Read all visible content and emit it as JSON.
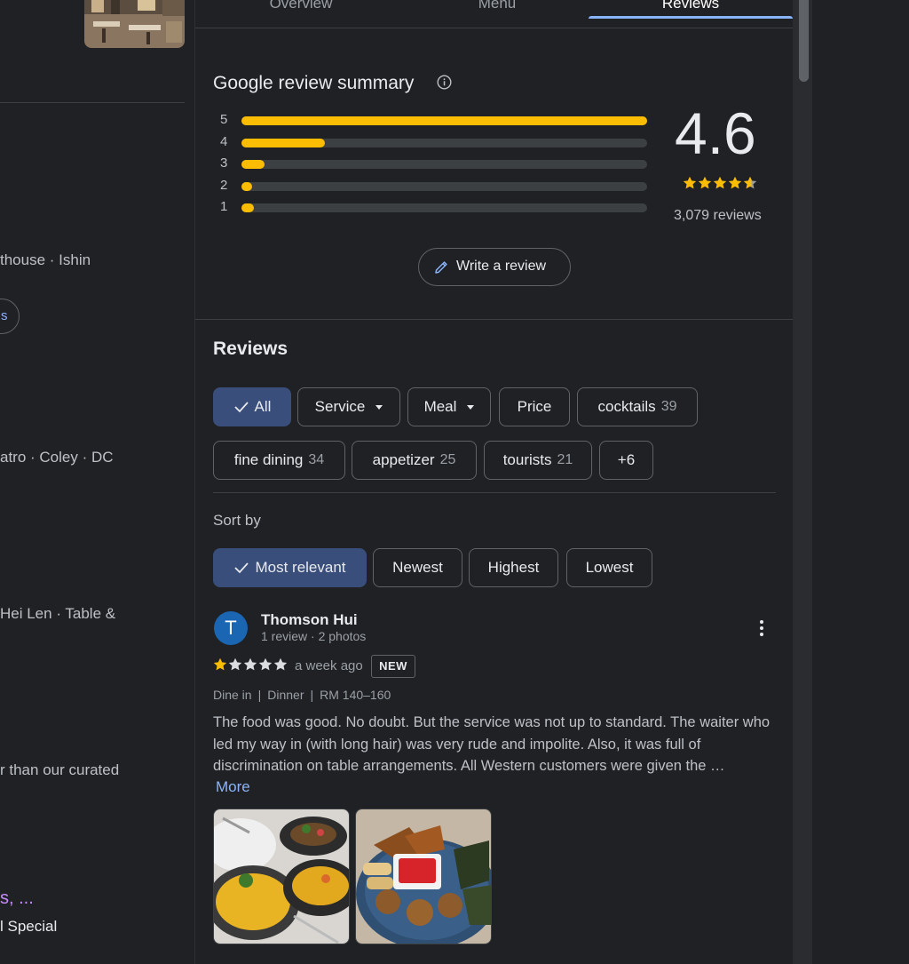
{
  "left": {
    "snippets": [
      "thouse · Ishin",
      "s",
      "atro · Coley · DC",
      "Hei Len · Table &",
      "r than our curated",
      "s, ...",
      "l Special"
    ]
  },
  "tabs": [
    {
      "label": "Overview",
      "active": false
    },
    {
      "label": "Menu",
      "active": false
    },
    {
      "label": "Reviews",
      "active": true
    }
  ],
  "summary": {
    "title": "Google review summary",
    "rating": "4.6",
    "stars": 4.6,
    "count_text": "3,079 reviews",
    "distribution": [
      {
        "stars": "5",
        "fraction": 1.0
      },
      {
        "stars": "4",
        "fraction": 0.205
      },
      {
        "stars": "3",
        "fraction": 0.057
      },
      {
        "stars": "2",
        "fraction": 0.02
      },
      {
        "stars": "1",
        "fraction": 0.03
      }
    ],
    "write_review_label": "Write a review"
  },
  "reviews_section": {
    "title": "Reviews",
    "filters": [
      {
        "label": "All",
        "count": "",
        "selected": true,
        "dropdown": false
      },
      {
        "label": "Service",
        "count": "",
        "selected": false,
        "dropdown": true
      },
      {
        "label": "Meal",
        "count": "",
        "selected": false,
        "dropdown": true
      },
      {
        "label": "Price",
        "count": "",
        "selected": false,
        "dropdown": false
      },
      {
        "label": "cocktails",
        "count": "39",
        "selected": false,
        "dropdown": false
      },
      {
        "label": "fine dining",
        "count": "34",
        "selected": false,
        "dropdown": false
      },
      {
        "label": "appetizer",
        "count": "25",
        "selected": false,
        "dropdown": false
      },
      {
        "label": "tourists",
        "count": "21",
        "selected": false,
        "dropdown": false
      },
      {
        "label": "+6",
        "count": "",
        "selected": false,
        "dropdown": false
      }
    ],
    "sort_label": "Sort by",
    "sort_options": [
      {
        "label": "Most relevant",
        "selected": true
      },
      {
        "label": "Newest",
        "selected": false
      },
      {
        "label": "Highest",
        "selected": false
      },
      {
        "label": "Lowest",
        "selected": false
      }
    ]
  },
  "review": {
    "avatar_letter": "T",
    "name": "Thomson Hui",
    "meta": "1 review · 2 photos",
    "stars": 1,
    "time": "a week ago",
    "badge": "NEW",
    "tags": [
      "Dine in",
      "Dinner",
      "RM 140–160"
    ],
    "text": "The food was good. No doubt. But the service was not up to standard. The waiter who led my way in (with long hair) was very rude and impolite. Also, it was full of discrimination on table arrangements. All Western customers were given the …",
    "more_label": "More"
  },
  "colors": {
    "star": "#fbbc04",
    "accent": "#8ab4f8",
    "selected_chip": "#394e7a",
    "avatar": "#1a66b3"
  }
}
